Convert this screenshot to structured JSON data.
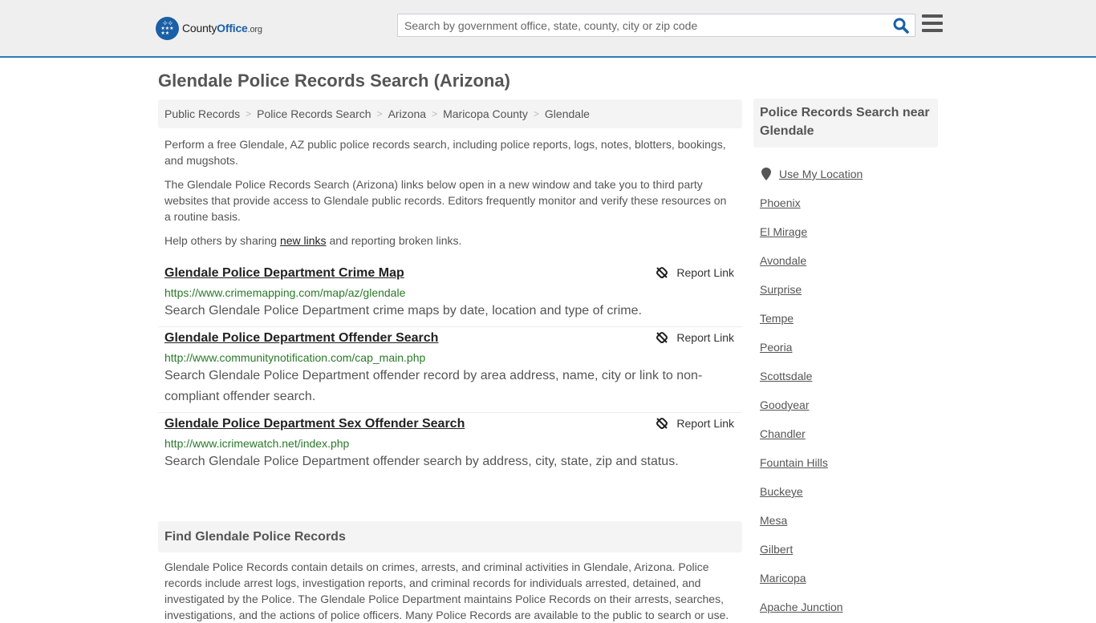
{
  "header": {
    "logo": {
      "name_part1": "County",
      "name_part2": "Office",
      "name_suffix": ".org"
    },
    "search": {
      "placeholder": "Search by government office, state, county, city or zip code",
      "value": ""
    },
    "colors": {
      "brand": "#1b5fa6",
      "accent_border": "#2f7ab8"
    }
  },
  "page": {
    "title": "Glendale Police Records Search (Arizona)"
  },
  "breadcrumb": [
    {
      "label": "Public Records"
    },
    {
      "label": "Police Records Search"
    },
    {
      "label": "Arizona"
    },
    {
      "label": "Maricopa County"
    },
    {
      "label": "Glendale"
    }
  ],
  "intro": {
    "p1": "Perform a free Glendale, AZ public police records search, including police reports, logs, notes, blotters, bookings, and mugshots.",
    "p2": "The Glendale Police Records Search (Arizona) links below open in a new window and take you to third party websites that provide access to Glendale public records. Editors frequently monitor and verify these resources on a routine basis.",
    "p3_before": "Help others by sharing ",
    "p3_link": "new links",
    "p3_after": " and reporting broken links."
  },
  "results": [
    {
      "title": "Glendale Police Department Crime Map",
      "url": "https://www.crimemapping.com/map/az/glendale",
      "description": "Search Glendale Police Department crime maps by date, location and type of crime.",
      "report_label": "Report Link"
    },
    {
      "title": "Glendale Police Department Offender Search",
      "url": "http://www.communitynotification.com/cap_main.php",
      "description": "Search Glendale Police Department offender record by area address, name, city or link to non-compliant offender search.",
      "report_label": "Report Link"
    },
    {
      "title": "Glendale Police Department Sex Offender Search",
      "url": "http://www.icrimewatch.net/index.php",
      "description": "Search Glendale Police Department offender search by address, city, state, zip and status.",
      "report_label": "Report Link"
    }
  ],
  "find_section": {
    "title": "Find Glendale Police Records",
    "text": "Glendale Police Records contain details on crimes, arrests, and criminal activities in Glendale, Arizona. Police records include arrest logs, investigation reports, and criminal records for individuals arrested, detained, and investigated by the Police. The Glendale Police Department maintains Police Records on their arrests, searches, investigations, and the actions of police officers. Many Police Records are available to the public to search or use."
  },
  "sidebar": {
    "title": "Police Records Search near Glendale",
    "use_location": "Use My Location",
    "cities": [
      "Phoenix",
      "El Mirage",
      "Avondale",
      "Surprise",
      "Tempe",
      "Peoria",
      "Scottsdale",
      "Goodyear",
      "Chandler",
      "Fountain Hills",
      "Buckeye",
      "Mesa",
      "Gilbert",
      "Maricopa",
      "Apache Junction"
    ]
  }
}
